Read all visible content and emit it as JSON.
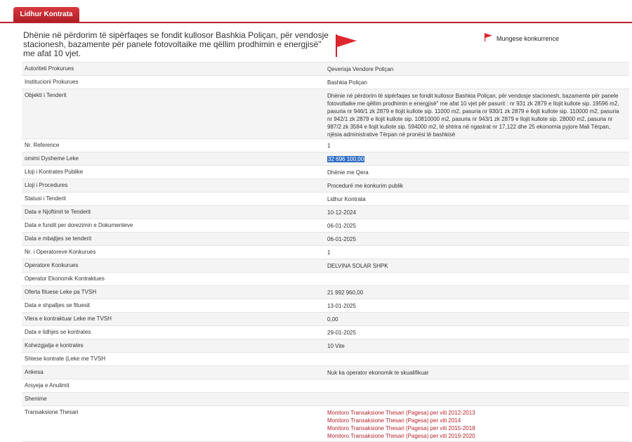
{
  "tab": {
    "label": "Lidhur Kontrata"
  },
  "title": "Dhënie në përdorim të sipërfaqes se fondit kullosor Bashkia Poliçan, për vendosje stacionesh, bazamente për panele fotovoltaike me qëllim prodhimin e energjisë\" me afat 10 vjet.",
  "mungese": "Mungese konkurrence",
  "colors": {
    "accent": "#b8232a",
    "selection": "#2f6fc2",
    "row_alt": "#f4f4f4"
  },
  "icons": {
    "flag": "red-flag-icon"
  },
  "rows": [
    {
      "label": "Autoriteti Prokurues",
      "value": "Qeverisja Vendore Poliçan"
    },
    {
      "label": "Institucioni Prokurues",
      "value": "Bashkia Poliçan"
    },
    {
      "label": "Objekti i Tenderit",
      "value": "Dhënie në përdorim të sipërfaqes se fondit kullosor Bashkia Poliçan, për vendosje stacionesh, bazamente për panele fotovoltaike me qëllim prodhimin e energjisë\" me afat 10 vjet për pasurit : nr 931 zk 2879 e llojit kullote sip. 19596 m2, pasuria nr 946/1 zk 2879 e llojit kullote sip. 11000 m2, pasuria nr 930/1 zk 2879 e llojit kullote sip. 110000 m2, pasuria nr 942/1 zk 2879 e llojit kullote sip. 10810000 m2, pasuria nr 943/1 zk 2879 e llojit kullote sip. 28000 m2, pasuria nr 987/2 zk 3584 e llojit kullote sip. 594000 m2, të shtrira në ngastrat nr 17,122 dhe 25 ekonomia pyjore Mali Tërpan, njësia administrative Tërpan në pronësi të bashkisë"
    },
    {
      "label": "Nr. Reference",
      "value": "1"
    },
    {
      "label": "omimi Dysheme Leke",
      "value": "32 696 100,00",
      "selected": true
    },
    {
      "label": "Lloji i Kontrates Publike",
      "value": "Dhënie me Qera"
    },
    {
      "label": "Lloji i Procedures",
      "value": "Procedurë me konkurim publik"
    },
    {
      "label": "Statusi i Tenderit",
      "value": "Lidhur Kontrata"
    },
    {
      "label": "Data e Njoftimit te Tenderit",
      "value": "10-12-2024"
    },
    {
      "label": "Data e fundit per dorezimin e Dokumenteve",
      "value": "06-01-2025"
    },
    {
      "label": "Data e mbajtjes se tenderit",
      "value": "06-01-2025"
    },
    {
      "label": "Nr. i Operatoreve Konkurues",
      "value": "1"
    },
    {
      "label": "Operatore Konkurues",
      "value": "DELVINA SOLAR SHPK"
    },
    {
      "label": "Operator Ekonomik Kontraktues",
      "value": ""
    },
    {
      "label": "Oferta fituese Leke pa TVSH",
      "value": "21 992 960,00"
    },
    {
      "label": "Data e shpalljes se fituesit",
      "value": "13-01-2025"
    },
    {
      "label": "Vlera e kontraktuar Leke me TVSH",
      "value": "0,00"
    },
    {
      "label": "Data e lidhjes se kontrates",
      "value": "29-01-2025"
    },
    {
      "label": "Kohezgjatja e kontrates",
      "value": "10 Vite"
    },
    {
      "label": "Shtese kontrate (Leke me TVSH",
      "value": ""
    },
    {
      "label": "Ankesa",
      "value": "Nuk ka operator ekonomik te skualifikuar"
    },
    {
      "label": "Arsyeja e Anulimit",
      "value": ""
    },
    {
      "label": "Shenime",
      "value": ""
    }
  ],
  "thesari": {
    "label": "Transaksione Thesari",
    "links": [
      "Monitoro Transaksione Thesari (Pagesa) per viti 2012-2013",
      "Monitoro Transaksione Thesari (Pagesa) per viti 2014",
      "Monitoro Transaksione Thesari (Pagesa) per viti 2015-2018",
      "Monitoro Transaksione Thesari (Pagesa) per viti 2019-2020"
    ]
  }
}
